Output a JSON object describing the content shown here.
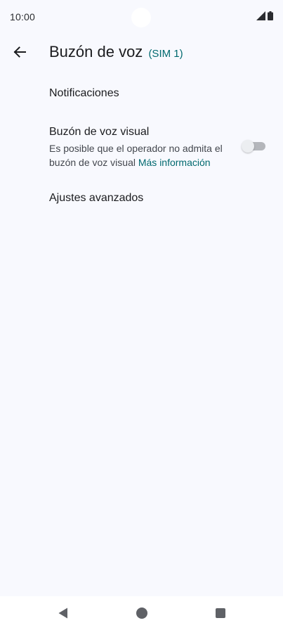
{
  "status_bar": {
    "time": "10:00",
    "icons": [
      "signal-icon",
      "battery-icon"
    ]
  },
  "header": {
    "back_icon": "arrow-back-icon",
    "title": "Buzón de voz",
    "sim_label": "(SIM 1)"
  },
  "settings": {
    "notifications": {
      "title": "Notificaciones"
    },
    "visual_voicemail": {
      "title": "Buzón de voz visual",
      "summary": "Es posible que el operador no admita el buzón de voz visual",
      "link": "Más información",
      "enabled": false
    },
    "advanced": {
      "title": "Ajustes avanzados"
    }
  },
  "navigation": {
    "icons": [
      "nav-back-icon",
      "nav-home-icon",
      "nav-recents-icon"
    ]
  },
  "colors": {
    "background": "#f8f9fe",
    "accent": "#00696f",
    "text_primary": "#1b1c1f",
    "text_secondary": "#43474e",
    "toggle_track_off": "#b4b6bb",
    "toggle_thumb_off": "#eceef1",
    "nav_bar": "#ffffff"
  }
}
